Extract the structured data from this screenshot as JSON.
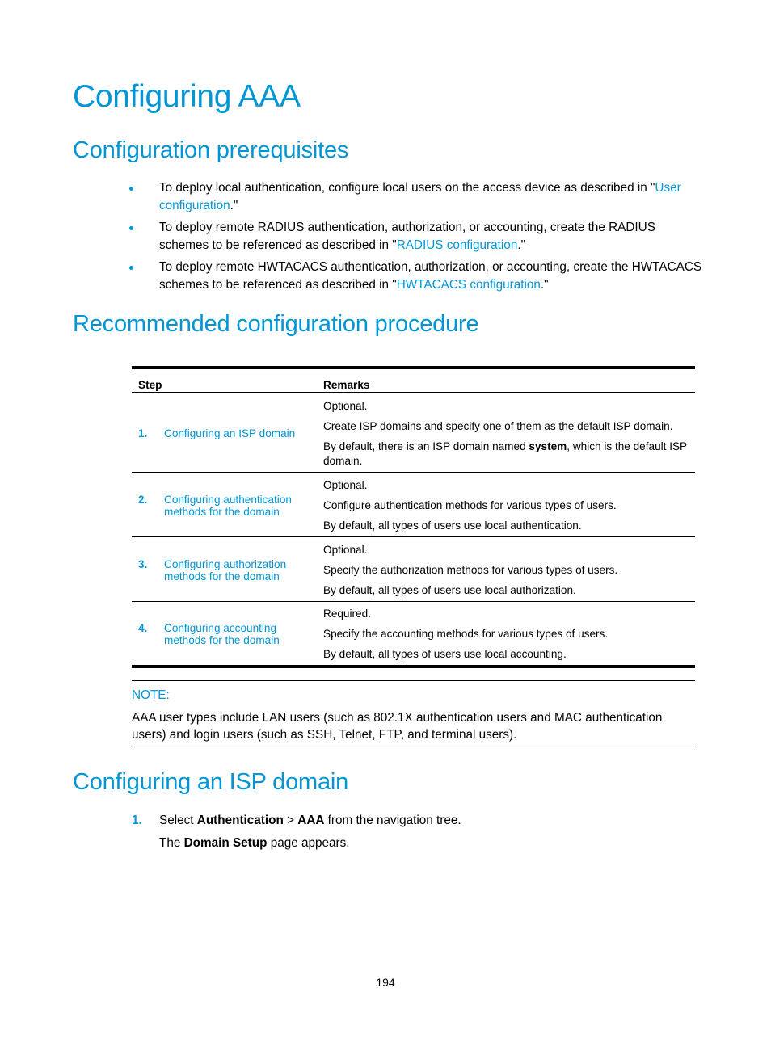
{
  "title": "Configuring AAA",
  "sections": {
    "prereq": {
      "heading": "Configuration prerequisites",
      "bullets": [
        {
          "before": "To deploy local authentication, configure local users on the access device as described in \"",
          "link": "User configuration",
          "after": ".\""
        },
        {
          "before": "To deploy remote RADIUS authentication, authorization, or accounting, create the RADIUS schemes to be referenced as described in \"",
          "link": "RADIUS configuration",
          "after": ".\""
        },
        {
          "before": "To deploy remote HWTACACS authentication, authorization, or accounting, create the HWTACACS schemes to be referenced as described in \"",
          "link": "HWTACACS configuration",
          "after": ".\""
        }
      ]
    },
    "procedure": {
      "heading": "Recommended configuration procedure",
      "table": {
        "headers": [
          "Step",
          "Remarks"
        ],
        "rows": [
          {
            "num": "1.",
            "step": "Configuring an ISP domain",
            "remarks": [
              "Optional.",
              "Create ISP domains and specify one of them as the default ISP domain."
            ],
            "last_before": "By default, there is an ISP domain named ",
            "last_bold": "system",
            "last_after": ", which is the default ISP domain."
          },
          {
            "num": "2.",
            "step": "Configuring authentication methods for the domain",
            "remarks": [
              "Optional.",
              "Configure authentication methods for various types of users.",
              "By default, all types of users use local authentication."
            ]
          },
          {
            "num": "3.",
            "step": "Configuring authorization methods for the domain",
            "remarks": [
              "Optional.",
              "Specify the authorization methods for various types of users.",
              "By default, all types of users use local authorization."
            ]
          },
          {
            "num": "4.",
            "step": "Configuring accounting methods for the domain",
            "remarks": [
              "Required.",
              "Specify the accounting methods for various types of users.",
              "By default, all types of users use local accounting."
            ]
          }
        ]
      },
      "note": {
        "label": "NOTE:",
        "text": "AAA user types include LAN users (such as 802.1X authentication users and MAC authentication users) and login users (such as SSH, Telnet, FTP, and terminal users)."
      }
    },
    "isp": {
      "heading": "Configuring an ISP domain",
      "step1": {
        "num": "1.",
        "t1": "Select ",
        "b1": "Authentication",
        "t2": " > ",
        "b2": "AAA",
        "t3": " from the navigation tree."
      },
      "step1_sub": {
        "t1": "The ",
        "b1": "Domain Setup",
        "t2": " page appears."
      }
    }
  },
  "page_number": "194"
}
